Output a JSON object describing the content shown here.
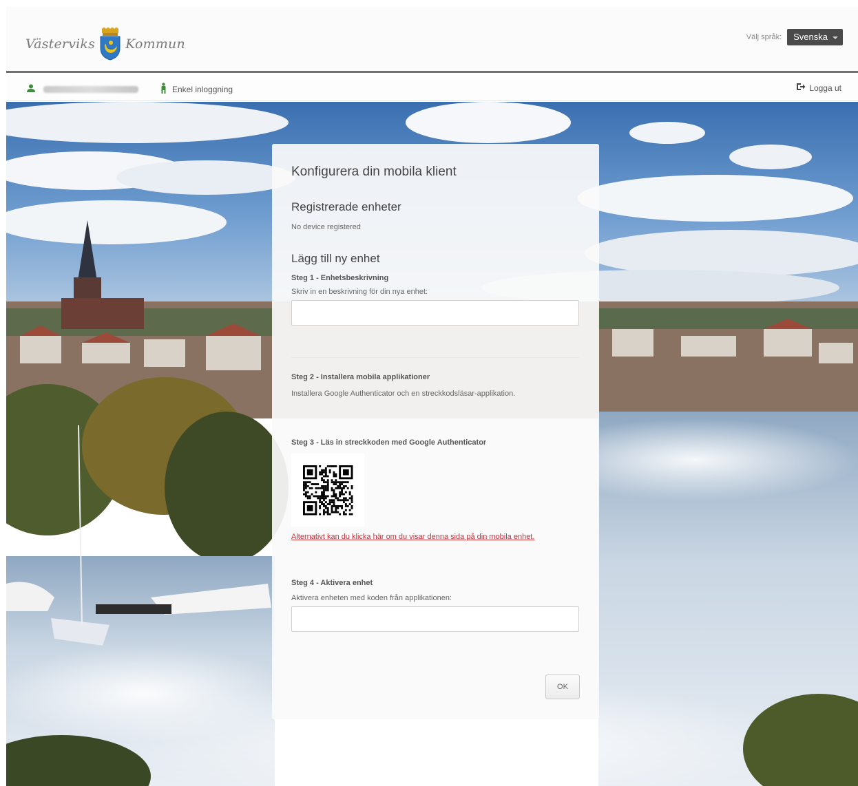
{
  "header": {
    "logo_left": "Västerviks",
    "logo_right": "Kommun",
    "language_label": "Välj språk:",
    "language_selected": "Svenska"
  },
  "subnav": {
    "sso_label": "Enkel inloggning",
    "logout_label": "Logga ut"
  },
  "card": {
    "title": "Konfigurera din mobila klient",
    "registered_heading": "Registrerade enheter",
    "no_device": "No device registered",
    "add_heading": "Lägg till ny enhet",
    "step1_title": "Steg 1 - Enhetsbeskrivning",
    "step1_text": "Skriv in en beskrivning för din nya enhet:",
    "step1_value": "",
    "step2_title": "Steg 2 - Installera mobila applikationer",
    "step2_text": "Installera Google Authenticator och en streckkodsläsar-applikation.",
    "step3_title": "Steg 3 - Läs in streckkoden med Google Authenticator",
    "step3_link": "Alternativt kan du klicka här om du visar denna sida på din mobila enhet.",
    "step4_title": "Steg 4 - Aktivera enhet",
    "step4_text": "Aktivera enheten med koden från applikationen:",
    "step4_value": "",
    "ok_label": "OK"
  },
  "colors": {
    "link": "#c8313a",
    "header_rule": "#707070",
    "icon_green": "#3f8f3a"
  },
  "icons": [
    "user-icon",
    "sso-person-icon",
    "logout-icon",
    "crest-icon",
    "qr-code",
    "chevron-down-icon"
  ]
}
